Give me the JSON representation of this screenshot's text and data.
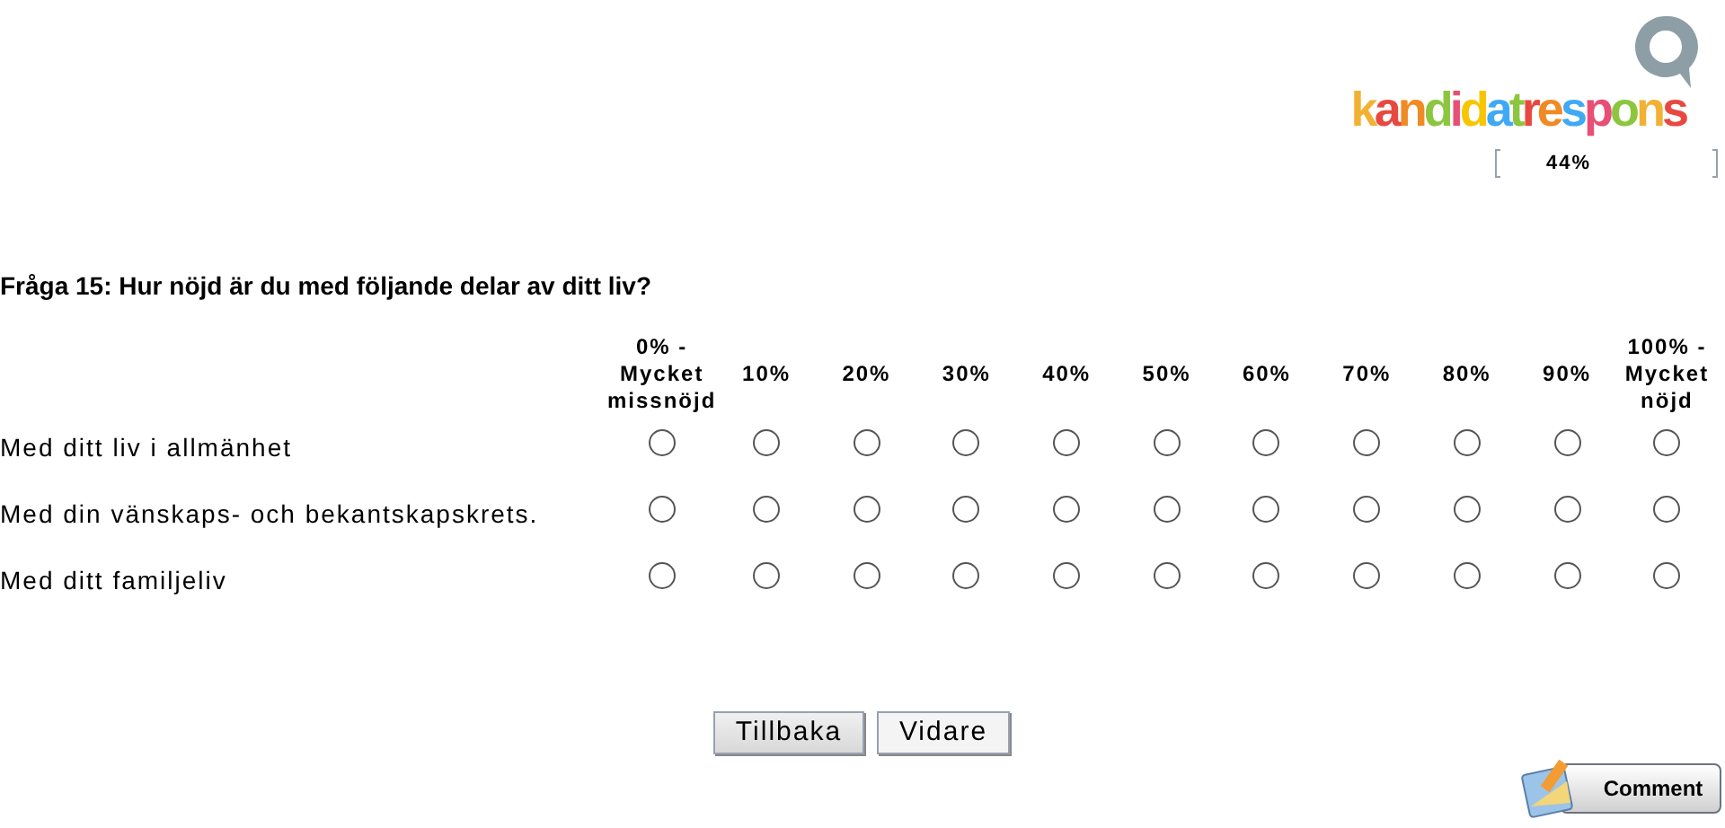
{
  "logo": {
    "text": "kandidatrespons"
  },
  "progress": {
    "text": "44%"
  },
  "question": {
    "title": "Fråga 15: Hur nöjd är du med följande delar av ditt liv?"
  },
  "columns": [
    [
      "0% -",
      "Mycket",
      "missnöjd"
    ],
    [
      "10%"
    ],
    [
      "20%"
    ],
    [
      "30%"
    ],
    [
      "40%"
    ],
    [
      "50%"
    ],
    [
      "60%"
    ],
    [
      "70%"
    ],
    [
      "80%"
    ],
    [
      "90%"
    ],
    [
      "100% -",
      "Mycket",
      "nöjd"
    ]
  ],
  "rows": [
    {
      "label": "Med ditt liv i allmänhet",
      "options": [
        false,
        false,
        false,
        false,
        false,
        false,
        false,
        false,
        false,
        false,
        false
      ]
    },
    {
      "label": "Med din vänskaps- och bekantskapskrets.",
      "options": [
        false,
        false,
        false,
        false,
        false,
        false,
        false,
        false,
        false,
        false,
        false
      ]
    },
    {
      "label": "Med ditt familjeliv",
      "options": [
        false,
        false,
        false,
        false,
        false,
        false,
        false,
        false,
        false,
        false,
        false
      ]
    }
  ],
  "buttons": [
    "Tillbaka",
    "Vidare"
  ],
  "comment_button": "Comment"
}
